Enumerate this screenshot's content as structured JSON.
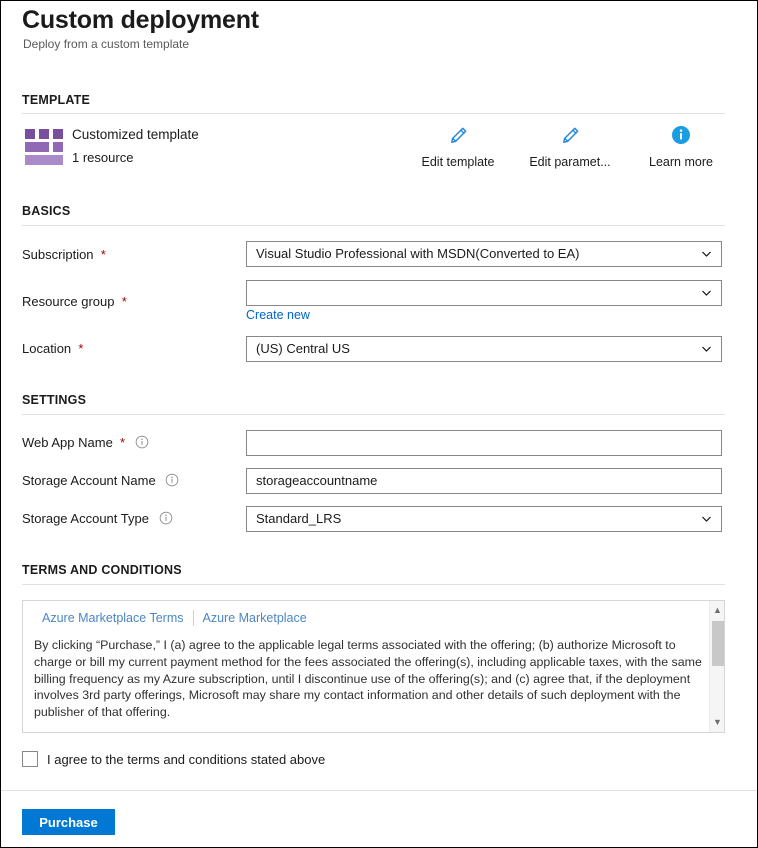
{
  "page": {
    "title": "Custom deployment",
    "subtitle": "Deploy from a custom template"
  },
  "colors": {
    "accent": "#0078d4",
    "link": "#0066cc",
    "required_asterisk": "#a80000",
    "template_icon": "#7a4e9e",
    "pencil_icon": "#2b88d8",
    "info_icon_filled": "#1b9de2"
  },
  "sections": {
    "template": {
      "heading": "TEMPLATE",
      "item": {
        "icon": "template-grid-icon",
        "title": "Customized template",
        "subtitle": "1 resource"
      },
      "commands": [
        {
          "icon": "pencil-icon",
          "label": "Edit template"
        },
        {
          "icon": "pencil-icon",
          "label": "Edit paramet..."
        },
        {
          "icon": "info-filled-icon",
          "label": "Learn more"
        }
      ]
    },
    "basics": {
      "heading": "BASICS",
      "fields": [
        {
          "label": "Subscription",
          "required": true,
          "control": "dropdown",
          "value": "Visual Studio Professional with MSDN(Converted to EA)",
          "has_info": false
        },
        {
          "label": "Resource group",
          "required": true,
          "control": "dropdown",
          "value": "",
          "has_info": false,
          "link": "Create new"
        },
        {
          "label": "Location",
          "required": true,
          "control": "dropdown",
          "value": "(US) Central US",
          "has_info": false
        }
      ]
    },
    "settings": {
      "heading": "SETTINGS",
      "fields": [
        {
          "label": "Web App Name",
          "required": true,
          "control": "text",
          "value": "",
          "has_info": true
        },
        {
          "label": "Storage Account Name",
          "required": false,
          "control": "text",
          "value": "storageaccountname",
          "has_info": true
        },
        {
          "label": "Storage Account Type",
          "required": false,
          "control": "dropdown",
          "value": "Standard_LRS",
          "has_info": true
        }
      ]
    },
    "terms": {
      "heading": "TERMS AND CONDITIONS",
      "tabs": [
        "Azure Marketplace Terms",
        "Azure Marketplace"
      ],
      "body": "By clicking “Purchase,” I (a) agree to the applicable legal terms associated with the offering; (b) authorize Microsoft to charge or bill my current payment method for the fees associated the offering(s), including applicable taxes, with the same billing frequency as my Azure subscription, until I discontinue use of the offering(s); and (c) agree that, if the deployment involves 3rd party offerings, Microsoft may share my contact information and other details of such deployment with the publisher of that offering.",
      "agree_label": "I agree to the terms and conditions stated above",
      "agree_checked": false
    }
  },
  "footer": {
    "purchase_label": "Purchase"
  }
}
